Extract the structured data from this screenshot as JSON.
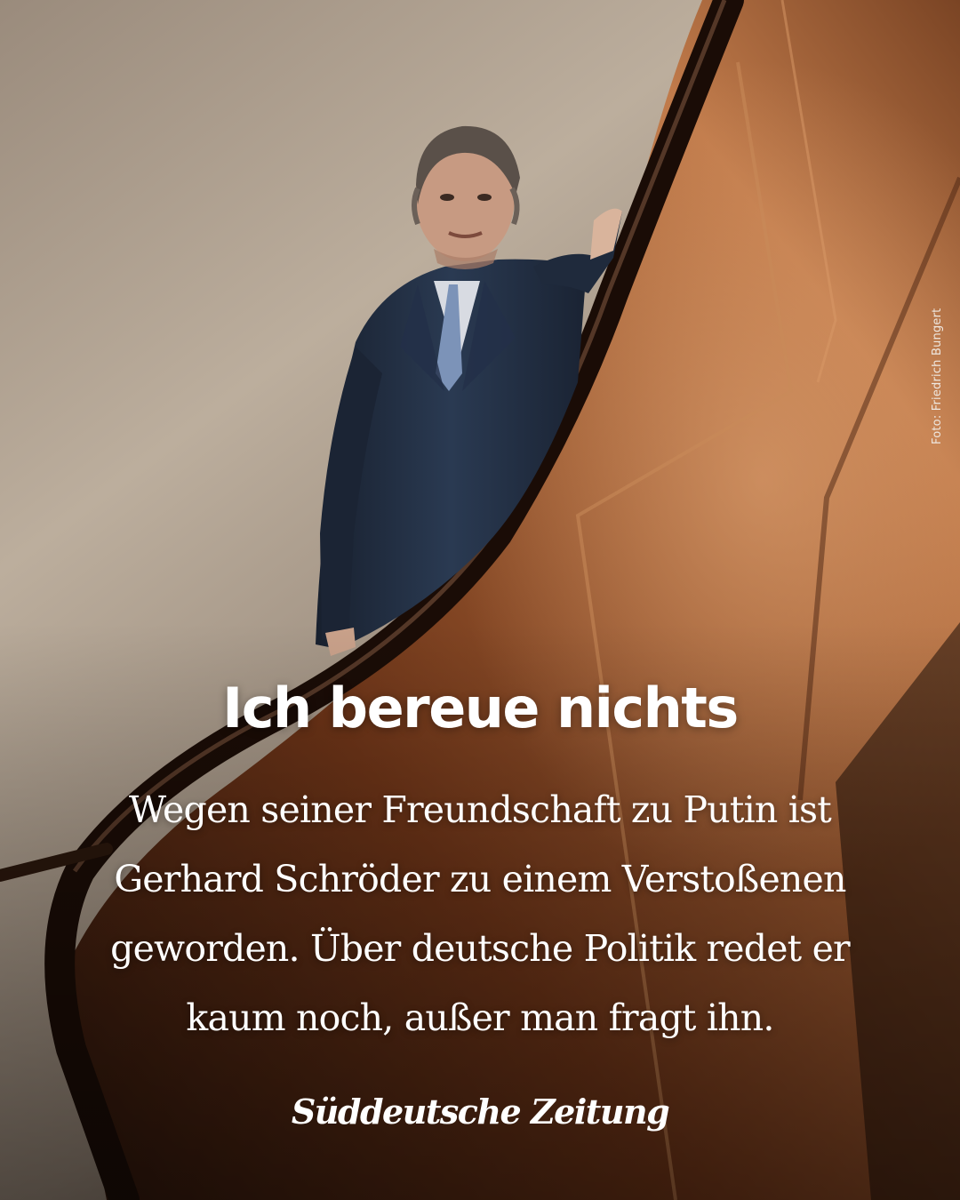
{
  "post": {
    "photo_credit": "Foto: Friedrich Bungert",
    "headline": "Ich bereue nichts",
    "teaser": "Wegen seiner Freundschaft zu Putin ist Gerhard Schröder zu einem Verstoßenen geworden. Über deutsche Politik redet er kaum noch, außer man fragt ihn.",
    "brand": "Süddeutsche Zeitung"
  },
  "colors": {
    "wall": "#b9aa98",
    "wood_dark": "#3a1d0f",
    "wood_light": "#a8643a",
    "suit": "#1f2a3c",
    "text": "#ffffff"
  }
}
